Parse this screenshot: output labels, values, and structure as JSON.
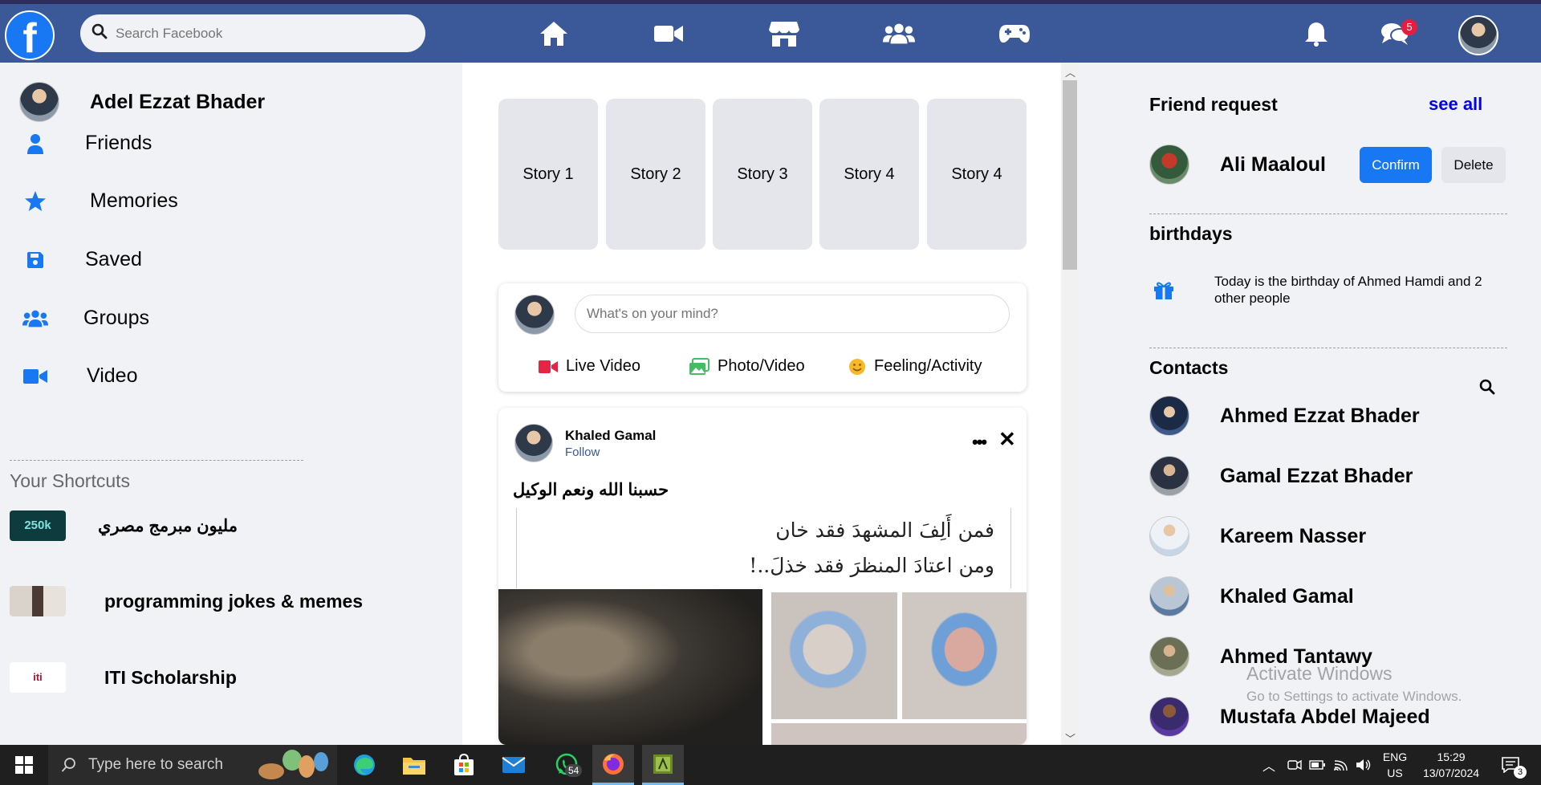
{
  "topbar": {
    "logo_letter": "f",
    "search_placeholder": "Search Facebook",
    "nav_icons": [
      "home-icon",
      "video-icon",
      "marketplace-icon",
      "groups-icon",
      "gaming-icon"
    ],
    "notification_icon": "bell-icon",
    "messenger_icon": "messenger-icon",
    "messenger_badge": "5"
  },
  "left_sidebar": {
    "profile_name": "Adel Ezzat Bhader",
    "menu": [
      {
        "label": "Friends",
        "icon": "person-icon"
      },
      {
        "label": "Memories",
        "icon": "star-icon"
      },
      {
        "label": "Saved",
        "icon": "save-icon"
      },
      {
        "label": "Groups",
        "icon": "users-icon"
      },
      {
        "label": "Video",
        "icon": "video-icon"
      }
    ],
    "shortcuts_title": "Your Shortcuts",
    "shortcuts": [
      {
        "label": "مليون مبرمج مصري",
        "thumb_text": "250k"
      },
      {
        "label": "programming jokes & memes"
      },
      {
        "label": "ITI Scholarship",
        "thumb_text": "iti"
      }
    ]
  },
  "feed": {
    "stories": [
      "Story 1",
      "Story 2",
      "Story 3",
      "Story 4",
      "Story 4"
    ],
    "composer": {
      "placeholder": "What's on your mind?",
      "actions": [
        {
          "label": "Live Video",
          "icon": "live-video-icon",
          "color": "#e42645"
        },
        {
          "label": "Photo/Video",
          "icon": "photo-icon",
          "color": "#45bd62"
        },
        {
          "label": "Feeling/Activity",
          "icon": "smile-icon",
          "color": "#f7b928"
        }
      ]
    },
    "post": {
      "author": "Khaled Gamal",
      "follow": "Follow",
      "text": "حسبنا الله ونعم الوكيل",
      "quote_line1": "فمن أَلِفَ المشهدَ فقد خان",
      "quote_line2": "ومن اعتادَ المنظرَ فقد خذلَ..!"
    }
  },
  "right_sidebar": {
    "friend_request_title": "Friend request",
    "see_all": "see all",
    "request": {
      "name": "Ali Maaloul",
      "confirm": "Confirm",
      "delete": "Delete"
    },
    "birthdays_title": "birthdays",
    "birthday_text": "Today is the birthday of Ahmed Hamdi and 2 other people",
    "contacts_title": "Contacts",
    "contacts": [
      "Ahmed Ezzat Bhader",
      "Gamal Ezzat Bhader",
      "Kareem Nasser",
      "Khaled Gamal",
      "Ahmed Tantawy",
      "Mustafa Abdel Majeed"
    ],
    "watermark_title": "Activate Windows",
    "watermark_sub": "Go to Settings to activate Windows."
  },
  "taskbar": {
    "search_placeholder": "Type here to search",
    "whatsapp_badge": "54",
    "lang_top": "ENG",
    "lang_bottom": "US",
    "time": "15:29",
    "date": "13/07/2024",
    "notification_count": "3"
  },
  "colors": {
    "topbar": "#3b5998",
    "accent": "#1877f2",
    "sidebar_icon": "#1877f2"
  }
}
